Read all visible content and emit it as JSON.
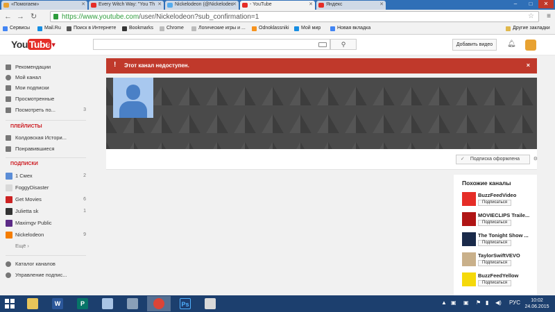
{
  "browser": {
    "tabs": [
      {
        "label": "«Помогаем»",
        "favicon_color": "#e8a232"
      },
      {
        "label": "Every Witch Way: \"You Th",
        "favicon_color": "#e52d27"
      },
      {
        "label": "Nickelodeon (@Nickelodeo",
        "favicon_color": "#55acee"
      },
      {
        "label": "- YouTube",
        "favicon_color": "#e52d27"
      },
      {
        "label": "Яндекс",
        "favicon_color": "#e52d27"
      }
    ],
    "url_host": "https://www.youtube.com",
    "url_path": "/user/Nickelodeon?sub_confirmation=1",
    "window_controls": [
      "–",
      "□",
      "✕"
    ]
  },
  "bookmarks": {
    "items": [
      {
        "label": "Сервисы",
        "color": "#4285f4"
      },
      {
        "label": "Mail.Ru",
        "color": "#168de2"
      },
      {
        "label": "Поиск в Интернете",
        "color": "#555555"
      },
      {
        "label": "Bookmarks",
        "color": "#333333"
      },
      {
        "label": "Chrome",
        "color": "#888888"
      },
      {
        "label": "Логические игры и ...",
        "color": "#888888"
      },
      {
        "label": "Odnoklassniki",
        "color": "#f7931e"
      },
      {
        "label": "Мой мир",
        "color": "#168de2"
      },
      {
        "label": "Новая вкладка",
        "color": "#4285f4"
      }
    ],
    "other": "Другие закладки"
  },
  "youtube": {
    "logo_you": "You",
    "logo_tube": "Tube",
    "upload_label": "Добавить видео"
  },
  "sidebar": {
    "main": [
      {
        "label": "Рекомендации",
        "count": ""
      },
      {
        "label": "Мой канал",
        "count": ""
      },
      {
        "label": "Мои подписки",
        "count": ""
      },
      {
        "label": "Просмотренные",
        "count": ""
      },
      {
        "label": "Посмотреть по...",
        "count": "3"
      }
    ],
    "playlists_head": "ПЛЕЙЛИСТЫ",
    "playlists": [
      {
        "label": "Колдовская Истори..."
      },
      {
        "label": "Понравившиеся"
      }
    ],
    "subs_head": "ПОДПИСКИ",
    "subs": [
      {
        "label": "1 Смех",
        "count": "2",
        "color": "#5b8dd6"
      },
      {
        "label": "FoggyDisaster",
        "count": "",
        "color": "#d9d9d9"
      },
      {
        "label": "Get Movies",
        "count": "6",
        "color": "#cc2222"
      },
      {
        "label": "Julietta sk",
        "count": "1",
        "color": "#333333"
      },
      {
        "label": "Maximgv Public",
        "count": "",
        "color": "#5b2a86"
      },
      {
        "label": "Nickelodeon",
        "count": "9",
        "color": "#f57d00"
      }
    ],
    "more": "Ещё ›",
    "bottom": [
      {
        "label": "Каталог каналов"
      },
      {
        "label": "Управление подпис..."
      }
    ]
  },
  "alert": {
    "icon": "!",
    "message": "Этот канал недоступен.",
    "close": "×"
  },
  "channel": {
    "subscribed_label": "Подписка оформлена"
  },
  "related": {
    "title": "Похожие каналы",
    "subscribe": "Подписаться",
    "items": [
      {
        "name": "BuzzFeedVideo",
        "color": "#e52d27"
      },
      {
        "name": "MOVIECLIPS Traile...",
        "color": "#b01515"
      },
      {
        "name": "The Tonight Show ...",
        "color": "#1a2a4a"
      },
      {
        "name": "TaylorSwiftVEVO",
        "color": "#c9b08a"
      },
      {
        "name": "BuzzFeedYellow",
        "color": "#f5d90a"
      }
    ]
  },
  "taskbar": {
    "lang": "РУС",
    "time": "10:02",
    "date": "24.06.2015"
  }
}
